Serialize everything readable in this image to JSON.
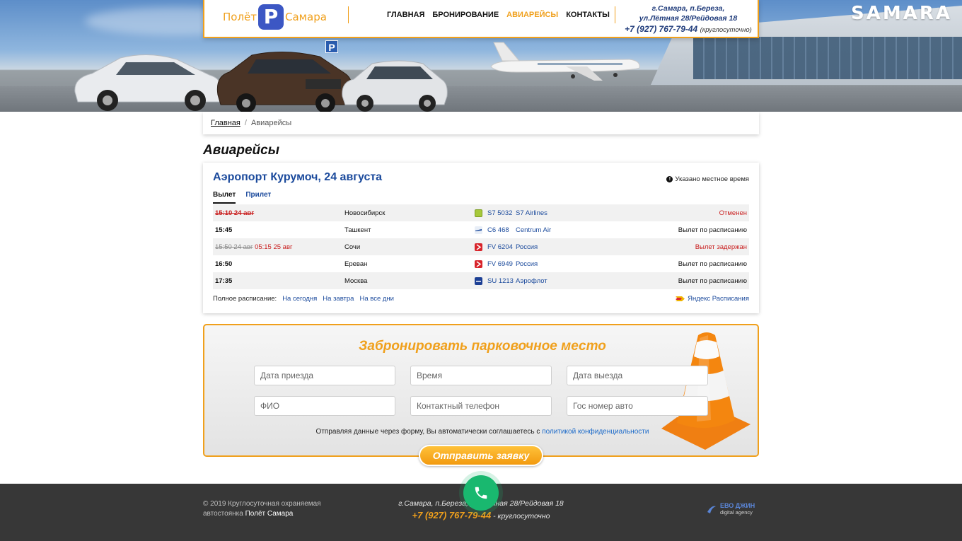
{
  "header": {
    "logo": {
      "left": "Полёт",
      "p": "P",
      "right": "Самара"
    },
    "nav": [
      {
        "label": "Главная",
        "active": false
      },
      {
        "label": "Бронирование",
        "active": false
      },
      {
        "label": "Авиарейсы",
        "active": true
      },
      {
        "label": "Контакты",
        "active": false
      }
    ],
    "address_line1": "г.Самара, п.Береза,",
    "address_line2": "ул.Лётная 28/Рейдовая 18",
    "phone": "+7 (927) 767-79-44",
    "phone_note": "(круглосуточно)"
  },
  "hero": {
    "sign": "SAMARA",
    "parking_sign": "P"
  },
  "breadcrumb": {
    "home": "Главная",
    "separator": "/",
    "current": "Авиарейсы"
  },
  "page_title": "Авиарейсы",
  "flights": {
    "title": "Аэропорт Курумоч, 24 августа",
    "note": "Указано местное время",
    "tabs": [
      {
        "label": "Вылет",
        "active": true
      },
      {
        "label": "Прилет",
        "active": false
      }
    ],
    "rows": [
      {
        "time": "15:10 24 авг",
        "time_new": "",
        "cancelled": true,
        "city": "Новосибирск",
        "code": "S7 5032",
        "airline": "S7 Airlines",
        "status": "Отменен",
        "status_red": true,
        "logo_color": "#a6c83a"
      },
      {
        "time": "15:45",
        "time_new": "",
        "cancelled": false,
        "city": "Ташкент",
        "code": "C6 468",
        "airline": "Centrum Air",
        "status": "Вылет по расписанию",
        "status_red": false,
        "logo_color": "#e8eef7"
      },
      {
        "time": "15:50 24 авг",
        "time_new": "05:15 25 авг",
        "cancelled": false,
        "city": "Сочи",
        "code": "FV 6204",
        "airline": "Россия",
        "status": "Вылет задержан",
        "status_red": true,
        "logo_color": "#d8232a"
      },
      {
        "time": "16:50",
        "time_new": "",
        "cancelled": false,
        "city": "Ереван",
        "code": "FV 6949",
        "airline": "Россия",
        "status": "Вылет по расписанию",
        "status_red": false,
        "logo_color": "#d8232a"
      },
      {
        "time": "17:35",
        "time_new": "",
        "cancelled": false,
        "city": "Москва",
        "code": "SU 1213",
        "airline": "Аэрофлот",
        "status": "Вылет по расписанию",
        "status_red": false,
        "logo_color": "#1c3f94"
      }
    ],
    "full_schedule_label": "Полное расписание:",
    "links": [
      "На сегодня",
      "На завтра",
      "На все дни"
    ],
    "yandex_label": "Яндекс Расписания"
  },
  "booking": {
    "title": "Забронировать парковочное место",
    "fields": {
      "arrival_date": "Дата приезда",
      "time": "Время",
      "departure_date": "Дата выезда",
      "name": "ФИО",
      "phone": "Контактный телефон",
      "plate": "Гос номер авто"
    },
    "consent_text": "Отправляя данные через форму, Вы автоматически соглашаетесь с",
    "consent_link": "политикой конфиденциальности",
    "submit_label": "Отправить заявку"
  },
  "footer": {
    "copyright": "© 2019 Круглосуточная охраняемая автостоянка",
    "brand": "Полёт Самара",
    "address": "г.Самара, п.Береза, ул.Лётная 28/Рейдовая 18",
    "phone": "+7 (927) 767-79-44",
    "phone_note": " - круглосуточно",
    "developer_name": "ЕВО ДЖИН",
    "developer_sub": "digital agency"
  },
  "colors": {
    "accent": "#f0a01c",
    "link": "#1b4a9c",
    "danger": "#c91e1e",
    "call": "#19b86f",
    "footer": "#373737"
  }
}
